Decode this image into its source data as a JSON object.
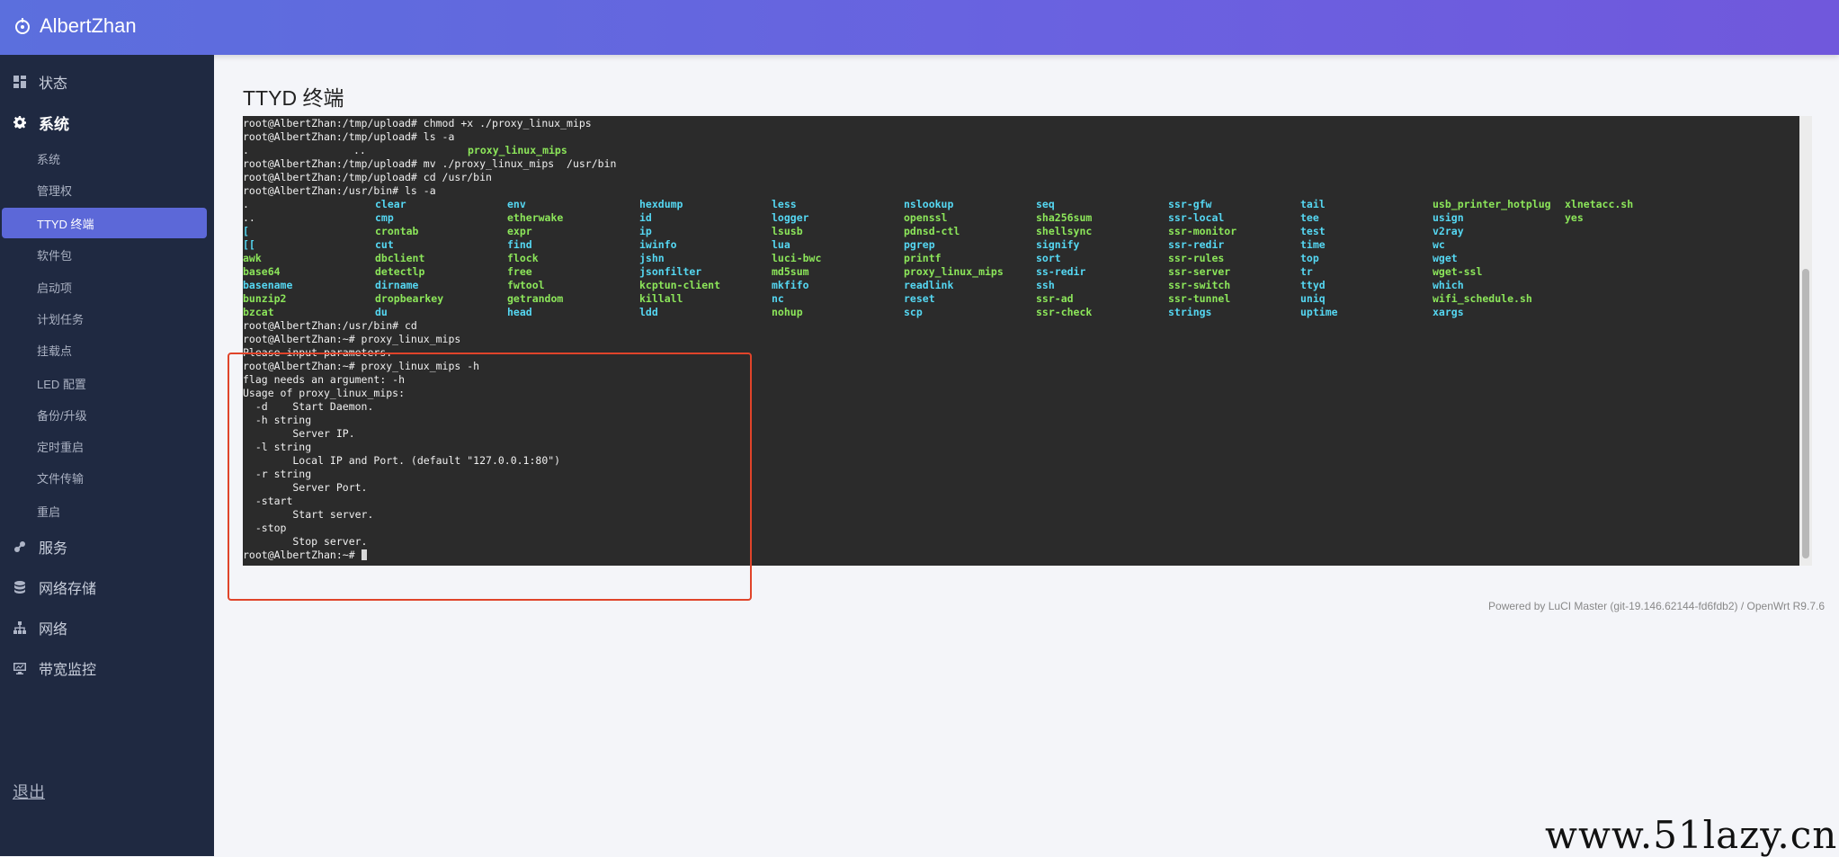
{
  "header": {
    "brand": "AlbertZhan"
  },
  "sidebar": {
    "top_items": [
      {
        "label": "状态",
        "icon": "dashboard-icon"
      },
      {
        "label": "系统",
        "icon": "gear-icon"
      },
      {
        "label": "服务",
        "icon": "link-icon"
      },
      {
        "label": "网络存储",
        "icon": "database-icon"
      },
      {
        "label": "网络",
        "icon": "network-icon"
      },
      {
        "label": "带宽监控",
        "icon": "monitor-icon"
      }
    ],
    "sub_items": [
      {
        "label": "系统"
      },
      {
        "label": "管理权"
      },
      {
        "label": "TTYD 终端"
      },
      {
        "label": "软件包"
      },
      {
        "label": "启动项"
      },
      {
        "label": "计划任务"
      },
      {
        "label": "挂载点"
      },
      {
        "label": "LED 配置"
      },
      {
        "label": "备份/升级"
      },
      {
        "label": "定时重启"
      },
      {
        "label": "文件传输"
      },
      {
        "label": "重启"
      }
    ],
    "active_top": "系统",
    "active_sub": "TTYD 终端",
    "logout": "退出"
  },
  "main": {
    "title": "TTYD 终端"
  },
  "terminal": {
    "lines_before": [
      "root@AlbertZhan:/tmp/upload# chmod +x ./proxy_linux_mips",
      "root@AlbertZhan:/tmp/upload# ls -a",
      {
        "type": "ls1",
        "cells": [
          ".",
          "..",
          "proxy_linux_mips"
        ]
      },
      "root@AlbertZhan:/tmp/upload# mv ./proxy_linux_mips  /usr/bin",
      "root@AlbertZhan:/tmp/upload# cd /usr/bin",
      "root@AlbertZhan:/usr/bin# ls -a"
    ],
    "ls_columns": [
      {
        "color": "mix",
        "items": [
          ".",
          "..",
          "[",
          "[[",
          "awk",
          "base64",
          "basename",
          "bunzip2",
          "bzcat"
        ]
      },
      {
        "color": "mix",
        "items": [
          "clear",
          "cmp",
          "crontab",
          "cut",
          "dbclient",
          "detectlp",
          "dirname",
          "dropbearkey",
          "du"
        ]
      },
      {
        "color": "mix",
        "items": [
          "env",
          "etherwake",
          "expr",
          "find",
          "flock",
          "free",
          "fwtool",
          "getrandom",
          "head"
        ]
      },
      {
        "color": "mix",
        "items": [
          "hexdump",
          "id",
          "ip",
          "iwinfo",
          "jshn",
          "jsonfilter",
          "kcptun-client",
          "killall",
          "ldd"
        ]
      },
      {
        "color": "mix",
        "items": [
          "less",
          "logger",
          "lsusb",
          "lua",
          "luci-bwc",
          "md5sum",
          "mkfifo",
          "nc",
          "nohup"
        ]
      },
      {
        "color": "mix",
        "items": [
          "nslookup",
          "openssl",
          "pdnsd-ctl",
          "pgrep",
          "printf",
          "proxy_linux_mips",
          "readlink",
          "reset",
          "scp"
        ]
      },
      {
        "color": "mix",
        "items": [
          "seq",
          "sha256sum",
          "shellsync",
          "signify",
          "sort",
          "ss-redir",
          "ssh",
          "ssr-ad",
          "ssr-check"
        ]
      },
      {
        "color": "mix",
        "items": [
          "ssr-gfw",
          "ssr-local",
          "ssr-monitor",
          "ssr-redir",
          "ssr-rules",
          "ssr-server",
          "ssr-switch",
          "ssr-tunnel",
          "strings"
        ]
      },
      {
        "color": "mix",
        "items": [
          "tail",
          "tee",
          "test",
          "time",
          "top",
          "tr",
          "ttyd",
          "uniq",
          "uptime"
        ]
      },
      {
        "color": "mix",
        "items": [
          "usb_printer_hotplug",
          "usign",
          "v2ray",
          "wc",
          "wget",
          "wget-ssl",
          "which",
          "wifi_schedule.sh",
          "xargs"
        ]
      },
      {
        "color": "mix",
        "items": [
          "xlnetacc.sh",
          "yes"
        ]
      }
    ],
    "lines_after": [
      "root@AlbertZhan:/usr/bin# cd",
      "root@AlbertZhan:~# proxy_linux_mips",
      "Please input parameters.",
      "root@AlbertZhan:~# proxy_linux_mips -h",
      "flag needs an argument: -h",
      "Usage of proxy_linux_mips:",
      "  -d    Start Daemon.",
      "  -h string",
      "        Server IP.",
      "  -l string",
      "        Local IP and Port. (default \"127.0.0.1:80\")",
      "  -r string",
      "        Server Port.",
      "  -start",
      "        Start server.",
      "  -stop",
      "        Stop server.",
      "root@AlbertZhan:~# "
    ]
  },
  "footer": "Powered by LuCI Master (git-19.146.62144-fd6fdb2) / OpenWrt R9.7.6",
  "watermark": "www.51lazy.cn",
  "colors": {
    "accent": "#5c68d8",
    "sidebar": "#1f2941",
    "terminal_bg": "#2b2b2b",
    "blue_entry": "#55d7f2",
    "green_entry": "#8ce65a",
    "highlight": "#e0442a"
  }
}
